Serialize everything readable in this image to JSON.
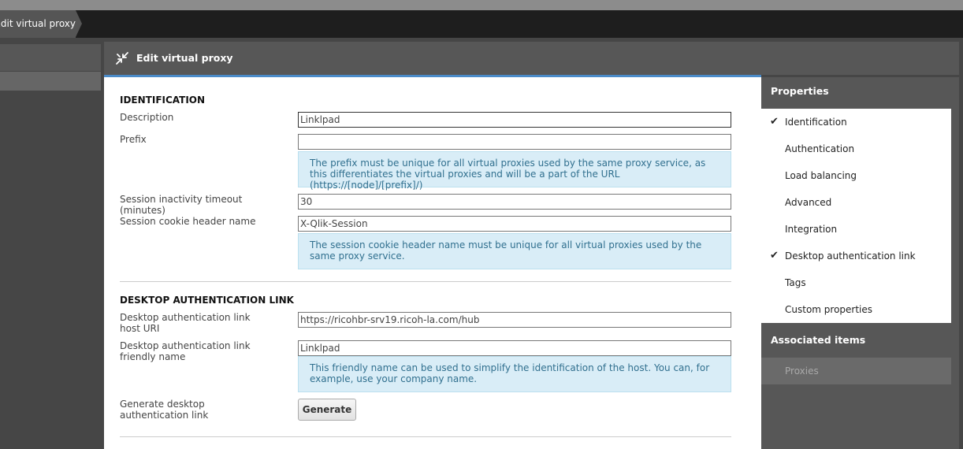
{
  "breadcrumb": {
    "label": "Edit virtual proxy"
  },
  "panel": {
    "title": "Edit virtual proxy"
  },
  "identification": {
    "heading": "IDENTIFICATION",
    "description_label": "Description",
    "description_value": "Linklpad",
    "prefix_label": "Prefix",
    "prefix_value": "",
    "prefix_hint": "The prefix must be unique for all virtual proxies used by the same proxy service, as this differentiates the virtual proxies and will be a part of the URL (https://[node]/[prefix]/)",
    "timeout_label": "Session inactivity timeout (minutes)",
    "timeout_value": "30",
    "cookie_label": "Session cookie header name",
    "cookie_value": "X-Qlik-Session",
    "cookie_hint": "The session cookie header name must be unique for all virtual proxies used by the same proxy service."
  },
  "desktop_auth": {
    "heading": "DESKTOP AUTHENTICATION LINK",
    "host_label": "Desktop authentication link host URI",
    "host_value": "https://ricohbr-srv19.ricoh-la.com/hub",
    "friendly_label": "Desktop authentication link friendly name",
    "friendly_value": "Linklpad",
    "friendly_hint": "This friendly name can be used to simplify the identification of the host. You can, for example, use your company name.",
    "generate_label": "Generate desktop authentication link",
    "generate_button": "Generate"
  },
  "sidebar": {
    "properties_heading": "Properties",
    "items": [
      {
        "label": "Identification",
        "checked": "✔"
      },
      {
        "label": "Authentication",
        "checked": ""
      },
      {
        "label": "Load balancing",
        "checked": ""
      },
      {
        "label": "Advanced",
        "checked": ""
      },
      {
        "label": "Integration",
        "checked": ""
      },
      {
        "label": "Desktop authentication link",
        "checked": "✔"
      },
      {
        "label": "Tags",
        "checked": ""
      },
      {
        "label": "Custom properties",
        "checked": ""
      }
    ],
    "associated_heading": "Associated items",
    "associated_items": [
      {
        "label": "Proxies"
      }
    ]
  },
  "icons": {
    "panel": "collapse-arrows-icon",
    "check": "checkmark-icon"
  },
  "colors": {
    "accent": "#4b8bc8",
    "hint_bg": "#d9edf7",
    "hint_text": "#31708f"
  }
}
